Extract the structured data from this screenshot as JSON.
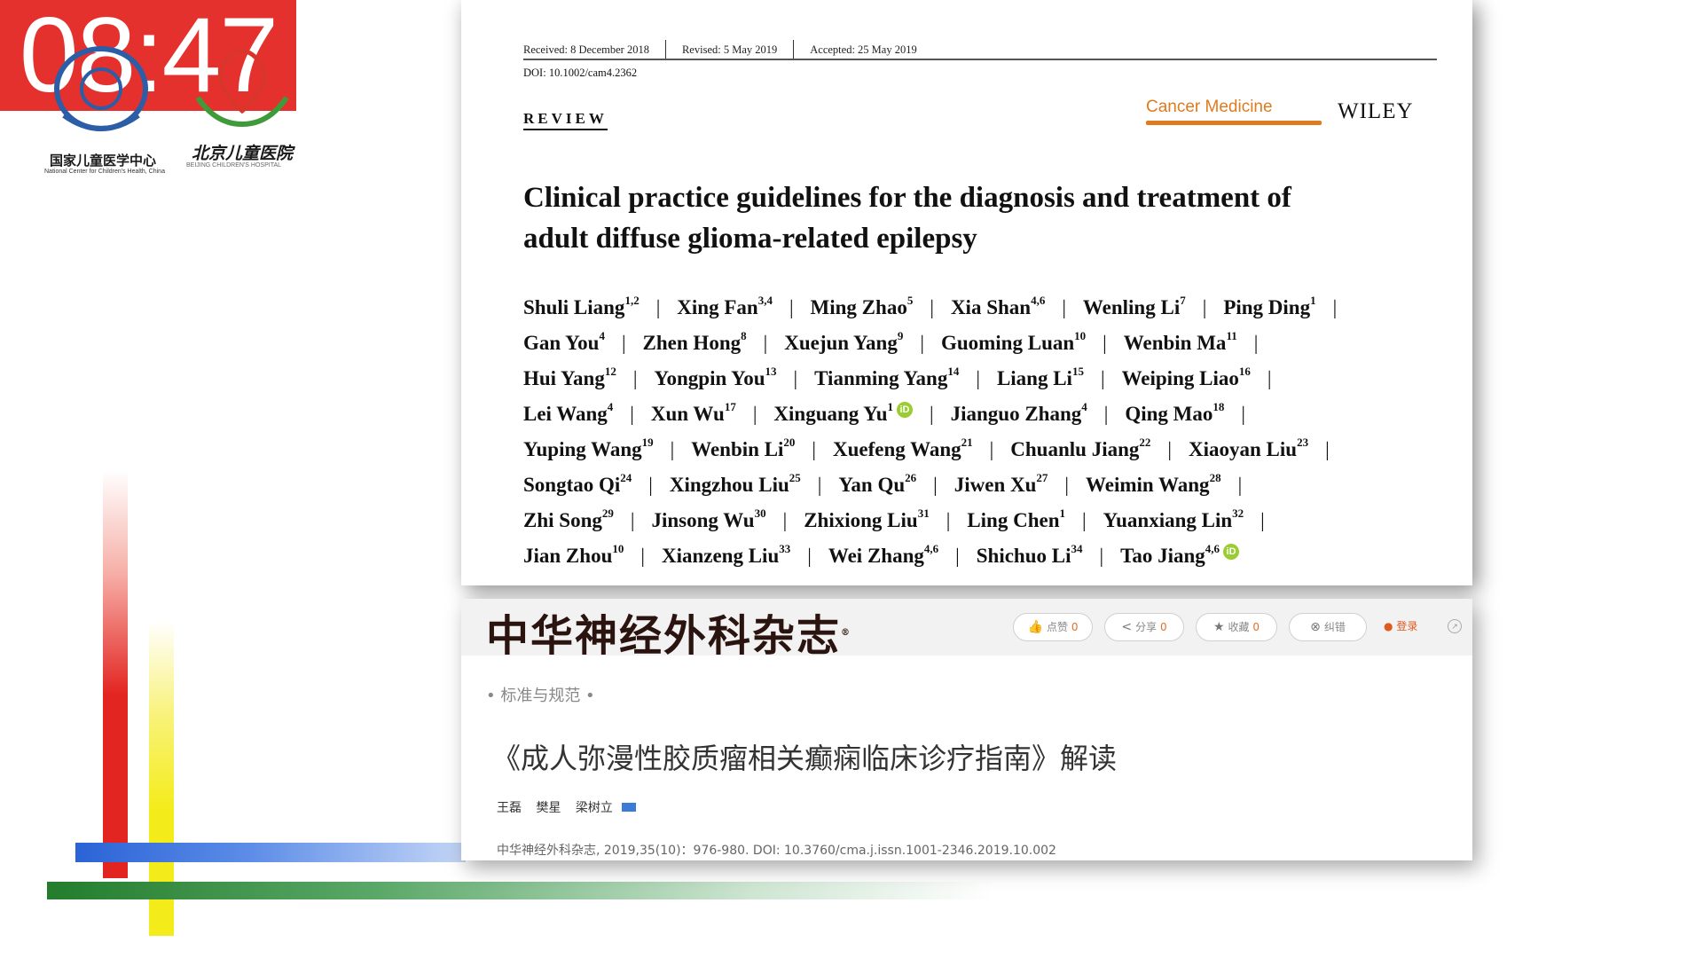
{
  "timer": "08:47",
  "logos": {
    "left_cn": "国家儿童医学中心",
    "left_en": "National Center for Children's Health, China",
    "right_cn": "北京儿童医院",
    "right_en": "BEIJING CHILDREN'S HOSPITAL"
  },
  "paper": {
    "received": "Received: 8 December 2018",
    "revised": "Revised: 5 May 2019",
    "accepted": "Accepted: 25 May 2019",
    "doi": "DOI: 10.1002/cam4.2362",
    "section": "REVIEW",
    "journal": "Cancer Medicine",
    "publisher": "WILEY",
    "title_line1": "Clinical practice guidelines for the diagnosis and treatment of",
    "title_line2": "adult diffuse glioma-related epilepsy",
    "author_rows": [
      [
        {
          "name": "Shuli Liang",
          "sup": "1,2"
        },
        {
          "name": "Xing Fan",
          "sup": "3,4"
        },
        {
          "name": "Ming Zhao",
          "sup": "5"
        },
        {
          "name": "Xia Shan",
          "sup": "4,6"
        },
        {
          "name": "Wenling Li",
          "sup": "7"
        },
        {
          "name": "Ping Ding",
          "sup": "1"
        }
      ],
      [
        {
          "name": "Gan You",
          "sup": "4"
        },
        {
          "name": "Zhen Hong",
          "sup": "8"
        },
        {
          "name": "Xuejun Yang",
          "sup": "9"
        },
        {
          "name": "Guoming Luan",
          "sup": "10"
        },
        {
          "name": "Wenbin Ma",
          "sup": "11"
        }
      ],
      [
        {
          "name": "Hui Yang",
          "sup": "12"
        },
        {
          "name": "Yongpin You",
          "sup": "13"
        },
        {
          "name": "Tianming Yang",
          "sup": "14"
        },
        {
          "name": "Liang Li",
          "sup": "15"
        },
        {
          "name": "Weiping Liao",
          "sup": "16"
        }
      ],
      [
        {
          "name": "Lei Wang",
          "sup": "4"
        },
        {
          "name": "Xun Wu",
          "sup": "17"
        },
        {
          "name": "Xinguang Yu",
          "sup": "1",
          "orcid": true
        },
        {
          "name": "Jianguo Zhang",
          "sup": "4"
        },
        {
          "name": "Qing Mao",
          "sup": "18"
        }
      ],
      [
        {
          "name": "Yuping Wang",
          "sup": "19"
        },
        {
          "name": "Wenbin Li",
          "sup": "20"
        },
        {
          "name": "Xuefeng Wang",
          "sup": "21"
        },
        {
          "name": "Chuanlu Jiang",
          "sup": "22"
        },
        {
          "name": "Xiaoyan Liu",
          "sup": "23"
        }
      ],
      [
        {
          "name": "Songtao Qi",
          "sup": "24"
        },
        {
          "name": "Xingzhou Liu",
          "sup": "25"
        },
        {
          "name": "Yan Qu",
          "sup": "26"
        },
        {
          "name": "Jiwen Xu",
          "sup": "27"
        },
        {
          "name": "Weimin Wang",
          "sup": "28"
        }
      ],
      [
        {
          "name": "Zhi Song",
          "sup": "29"
        },
        {
          "name": "Jinsong Wu",
          "sup": "30"
        },
        {
          "name": "Zhixiong Liu",
          "sup": "31"
        },
        {
          "name": "Ling Chen",
          "sup": "1"
        },
        {
          "name": "Yuanxiang Lin",
          "sup": "32"
        }
      ],
      [
        {
          "name": "Jian Zhou",
          "sup": "10"
        },
        {
          "name": "Xianzeng Liu",
          "sup": "33"
        },
        {
          "name": "Wei Zhang",
          "sup": "4,6"
        },
        {
          "name": "Shichuo Li",
          "sup": "34"
        },
        {
          "name": "Tao Jiang",
          "sup": "4,6",
          "orcid": true
        }
      ]
    ],
    "row_trailing_sep": [
      true,
      true,
      true,
      true,
      true,
      true,
      true,
      false
    ]
  },
  "cn_page": {
    "logo": "中华神经外科杂志",
    "logo_mark": "®",
    "toolbar": [
      {
        "icon": "👍",
        "label": "点赞",
        "count": "0"
      },
      {
        "icon": "<",
        "label": "分享",
        "count": "0"
      },
      {
        "icon": "★",
        "label": "收藏",
        "count": "0"
      },
      {
        "icon": "⊗",
        "label": "纠错",
        "count": ""
      }
    ],
    "login": "登录",
    "category": "• 标准与规范 •",
    "title": "《成人弥漫性胶质瘤相关癫痫临床诊疗指南》解读",
    "authors": [
      "王磊",
      "樊星",
      "梁树立"
    ],
    "citation": "中华神经外科杂志, 2019,35(10)：976-980. DOI: 10.3760/cma.j.issn.1001-2346.2019.10.002"
  },
  "colors": {
    "timer_bg": "#e5312d",
    "journal_orange": "#e07a1f",
    "orcid_green": "#9acd32"
  }
}
